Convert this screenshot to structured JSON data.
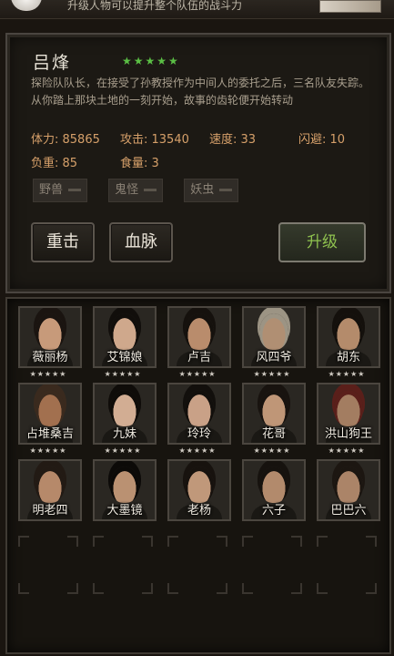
{
  "top": {
    "hint": "升级人物可以提升整个队伍的战斗力"
  },
  "hero": {
    "name": "吕烽",
    "stars": "★★★★★",
    "description": "探险队队长，在接受了孙教授作为中间人的委托之后，三名队友失踪。从你踏上那块土地的一刻开始，故事的齿轮便开始转动",
    "stats": {
      "hp": "体力: 85865",
      "attack": "攻击: 13540",
      "speed": "速度: 33",
      "dodge": "闪避: 10",
      "load": "负重: 85",
      "food": "食量: 3"
    },
    "tags": [
      "野兽",
      "鬼怪",
      "妖虫"
    ]
  },
  "buttons": {
    "heavy_strike": "重击",
    "bloodline": "血脉",
    "upgrade": "升级"
  },
  "card_stars": "★★★★★",
  "characters": [
    {
      "name": "薇丽杨",
      "skin": "#c79a7a",
      "hair": "#1a1410"
    },
    {
      "name": "艾锦娘",
      "skin": "#cfa88c",
      "hair": "#110e0b"
    },
    {
      "name": "卢吉",
      "skin": "#b98c6c",
      "hair": "#15110d"
    },
    {
      "name": "风四爷",
      "skin": "#b08f73",
      "hair": "#9c9484"
    },
    {
      "name": "胡东",
      "skin": "#b48b6b",
      "hair": "#14100c"
    },
    {
      "name": "占堆桑吉",
      "skin": "#a2704f",
      "hair": "#3a2a1e"
    },
    {
      "name": "九妹",
      "skin": "#d2ad93",
      "hair": "#0f0c09"
    },
    {
      "name": "玲玲",
      "skin": "#c9a187",
      "hair": "#120f0c"
    },
    {
      "name": "花哥",
      "skin": "#bf9677",
      "hair": "#18130f"
    },
    {
      "name": "洪山狗王",
      "skin": "#a37d61",
      "hair": "#5a1f1a"
    },
    {
      "name": "明老四",
      "skin": "#b6896a",
      "hair": "#221a14"
    },
    {
      "name": "大墨镜",
      "skin": "#ba9172",
      "hair": "#0c0a08"
    },
    {
      "name": "老杨",
      "skin": "#c0987a",
      "hair": "#17120e"
    },
    {
      "name": "六子",
      "skin": "#b28a6c",
      "hair": "#16120e"
    },
    {
      "name": "巴巴六",
      "skin": "#ab8468",
      "hair": "#1c1611"
    }
  ],
  "icons": {
    "top_left": "white-ore-icon",
    "top_right": "scene-thumbnail-icon"
  },
  "colors": {
    "star_green": "#5bbf45",
    "stat_orange": "#d6a06a",
    "upgrade_green": "#8fc24f"
  }
}
